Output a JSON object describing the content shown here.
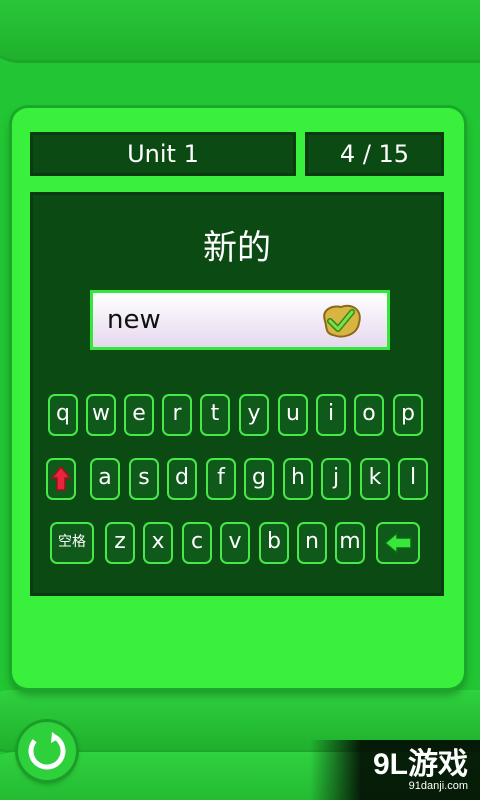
{
  "header": {
    "unit_label": "Unit 1",
    "progress_label": "4 / 15"
  },
  "question": {
    "prompt_word": "新的",
    "answer_value": "new"
  },
  "keyboard": {
    "row1": [
      "q",
      "w",
      "e",
      "r",
      "t",
      "y",
      "u",
      "i",
      "o",
      "p"
    ],
    "row2": [
      "a",
      "s",
      "d",
      "f",
      "g",
      "h",
      "j",
      "k",
      "l"
    ],
    "row3": [
      "z",
      "x",
      "c",
      "v",
      "b",
      "n",
      "m"
    ],
    "space_label": "空格"
  },
  "watermark": {
    "brand": "9L游戏",
    "site": "91danji.com"
  },
  "colors": {
    "background": "#22c533",
    "panel": "#39f03c",
    "board": "#0c4a14",
    "key_border": "#46e84a",
    "shift_arrow": "#e8253a",
    "backspace_arrow": "#39e63c"
  }
}
